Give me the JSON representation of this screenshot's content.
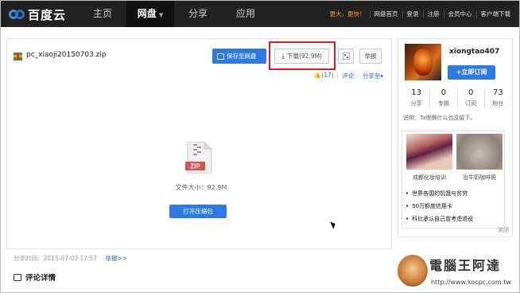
{
  "nav": {
    "brand": "百度云",
    "items": [
      {
        "label": "主页"
      },
      {
        "label": "网盘",
        "active": true
      },
      {
        "label": "分享"
      },
      {
        "label": "应用"
      }
    ],
    "promo": "更大，更快！",
    "links": [
      "网盘首页",
      "登录",
      "注册",
      "会员中心",
      "客户端下载"
    ]
  },
  "file": {
    "name": "pc_xiaoji20150703.zip",
    "save_label": "保存至网盘",
    "download_label": "下载(92.9M)",
    "report_label": "举报",
    "like_label": "(17)",
    "comment_label": "评论",
    "share_label": "分享至",
    "zip_badge": "ZIP",
    "size_text": "文件大小：92.9M",
    "open_label": "打开压缩包",
    "share_time": "分享时间：2015-07-03 17:57",
    "report_link": "举报>>",
    "comments_title": "评论详情"
  },
  "user": {
    "name": "xiongtao407",
    "follow_label": "+立即订阅",
    "stats": [
      {
        "count": "13",
        "label": "分享"
      },
      {
        "count": "0",
        "label": "专辑"
      },
      {
        "count": "0",
        "label": "订阅"
      },
      {
        "count": "73",
        "label": "粉丝"
      }
    ],
    "bio": "说明：Ta很懒什么也没留下。"
  },
  "ads": {
    "captions": [
      "成都化妆培训",
      "治牛奶咖啡斑"
    ],
    "items": [
      "世界各国的饥饿与贫穷",
      "50万额度信用卡",
      "科比承认自己曾考虑退役"
    ],
    "close": "关闭"
  },
  "watermark": {
    "title": "電腦王阿達",
    "url": "http://www.kocpc.com.tw"
  },
  "colors": {
    "accent": "#2c7be5",
    "highlight": "#d81e1e",
    "nav_bg": "#222222"
  }
}
